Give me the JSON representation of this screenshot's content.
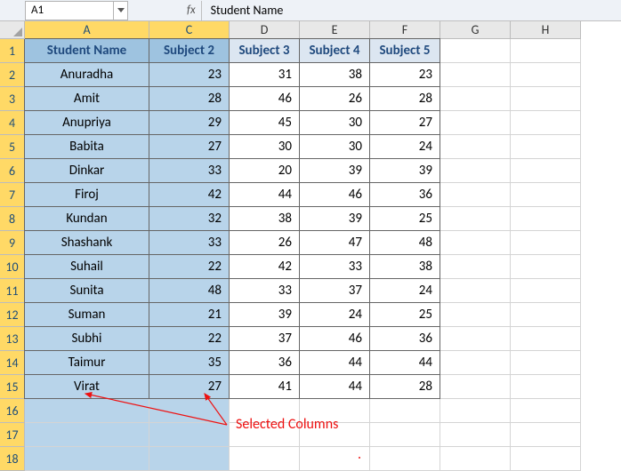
{
  "namebox": {
    "ref": "A1"
  },
  "formula_bar": {
    "fx_label": "fx",
    "content": "Student Name"
  },
  "col_headers": [
    "",
    "A",
    "C",
    "D",
    "E",
    "F",
    "G",
    "H"
  ],
  "row_headers": [
    "1",
    "2",
    "3",
    "4",
    "5",
    "6",
    "7",
    "8",
    "9",
    "10",
    "11",
    "12",
    "13",
    "14",
    "15",
    "16",
    "17",
    "18"
  ],
  "selected_cols": [
    "A",
    "C"
  ],
  "table": {
    "headers": [
      "Student Name",
      "Subject 2",
      "Subject 3",
      "Subject 4",
      "Subject 5"
    ],
    "rows": [
      {
        "name": "Anuradha",
        "s2": 23,
        "s3": 31,
        "s4": 38,
        "s5": 23
      },
      {
        "name": "Amit",
        "s2": 28,
        "s3": 46,
        "s4": 26,
        "s5": 28
      },
      {
        "name": "Anupriya",
        "s2": 29,
        "s3": 45,
        "s4": 30,
        "s5": 27
      },
      {
        "name": "Babita",
        "s2": 27,
        "s3": 30,
        "s4": 30,
        "s5": 24
      },
      {
        "name": "Dinkar",
        "s2": 33,
        "s3": 20,
        "s4": 39,
        "s5": 39
      },
      {
        "name": "Firoj",
        "s2": 42,
        "s3": 44,
        "s4": 46,
        "s5": 36
      },
      {
        "name": "Kundan",
        "s2": 32,
        "s3": 38,
        "s4": 39,
        "s5": 25
      },
      {
        "name": "Shashank",
        "s2": 33,
        "s3": 26,
        "s4": 47,
        "s5": 48
      },
      {
        "name": "Suhail",
        "s2": 22,
        "s3": 42,
        "s4": 33,
        "s5": 38
      },
      {
        "name": "Sunita",
        "s2": 48,
        "s3": 33,
        "s4": 37,
        "s5": 24
      },
      {
        "name": "Suman",
        "s2": 21,
        "s3": 39,
        "s4": 24,
        "s5": 25
      },
      {
        "name": "Subhi",
        "s2": 22,
        "s3": 37,
        "s4": 46,
        "s5": 36
      },
      {
        "name": "Taimur",
        "s2": 35,
        "s3": 36,
        "s4": 44,
        "s5": 44
      },
      {
        "name": "Virat",
        "s2": 27,
        "s3": 41,
        "s4": 44,
        "s5": 28
      }
    ]
  },
  "annotation": {
    "text": "Selected Columns",
    "dot": "."
  }
}
